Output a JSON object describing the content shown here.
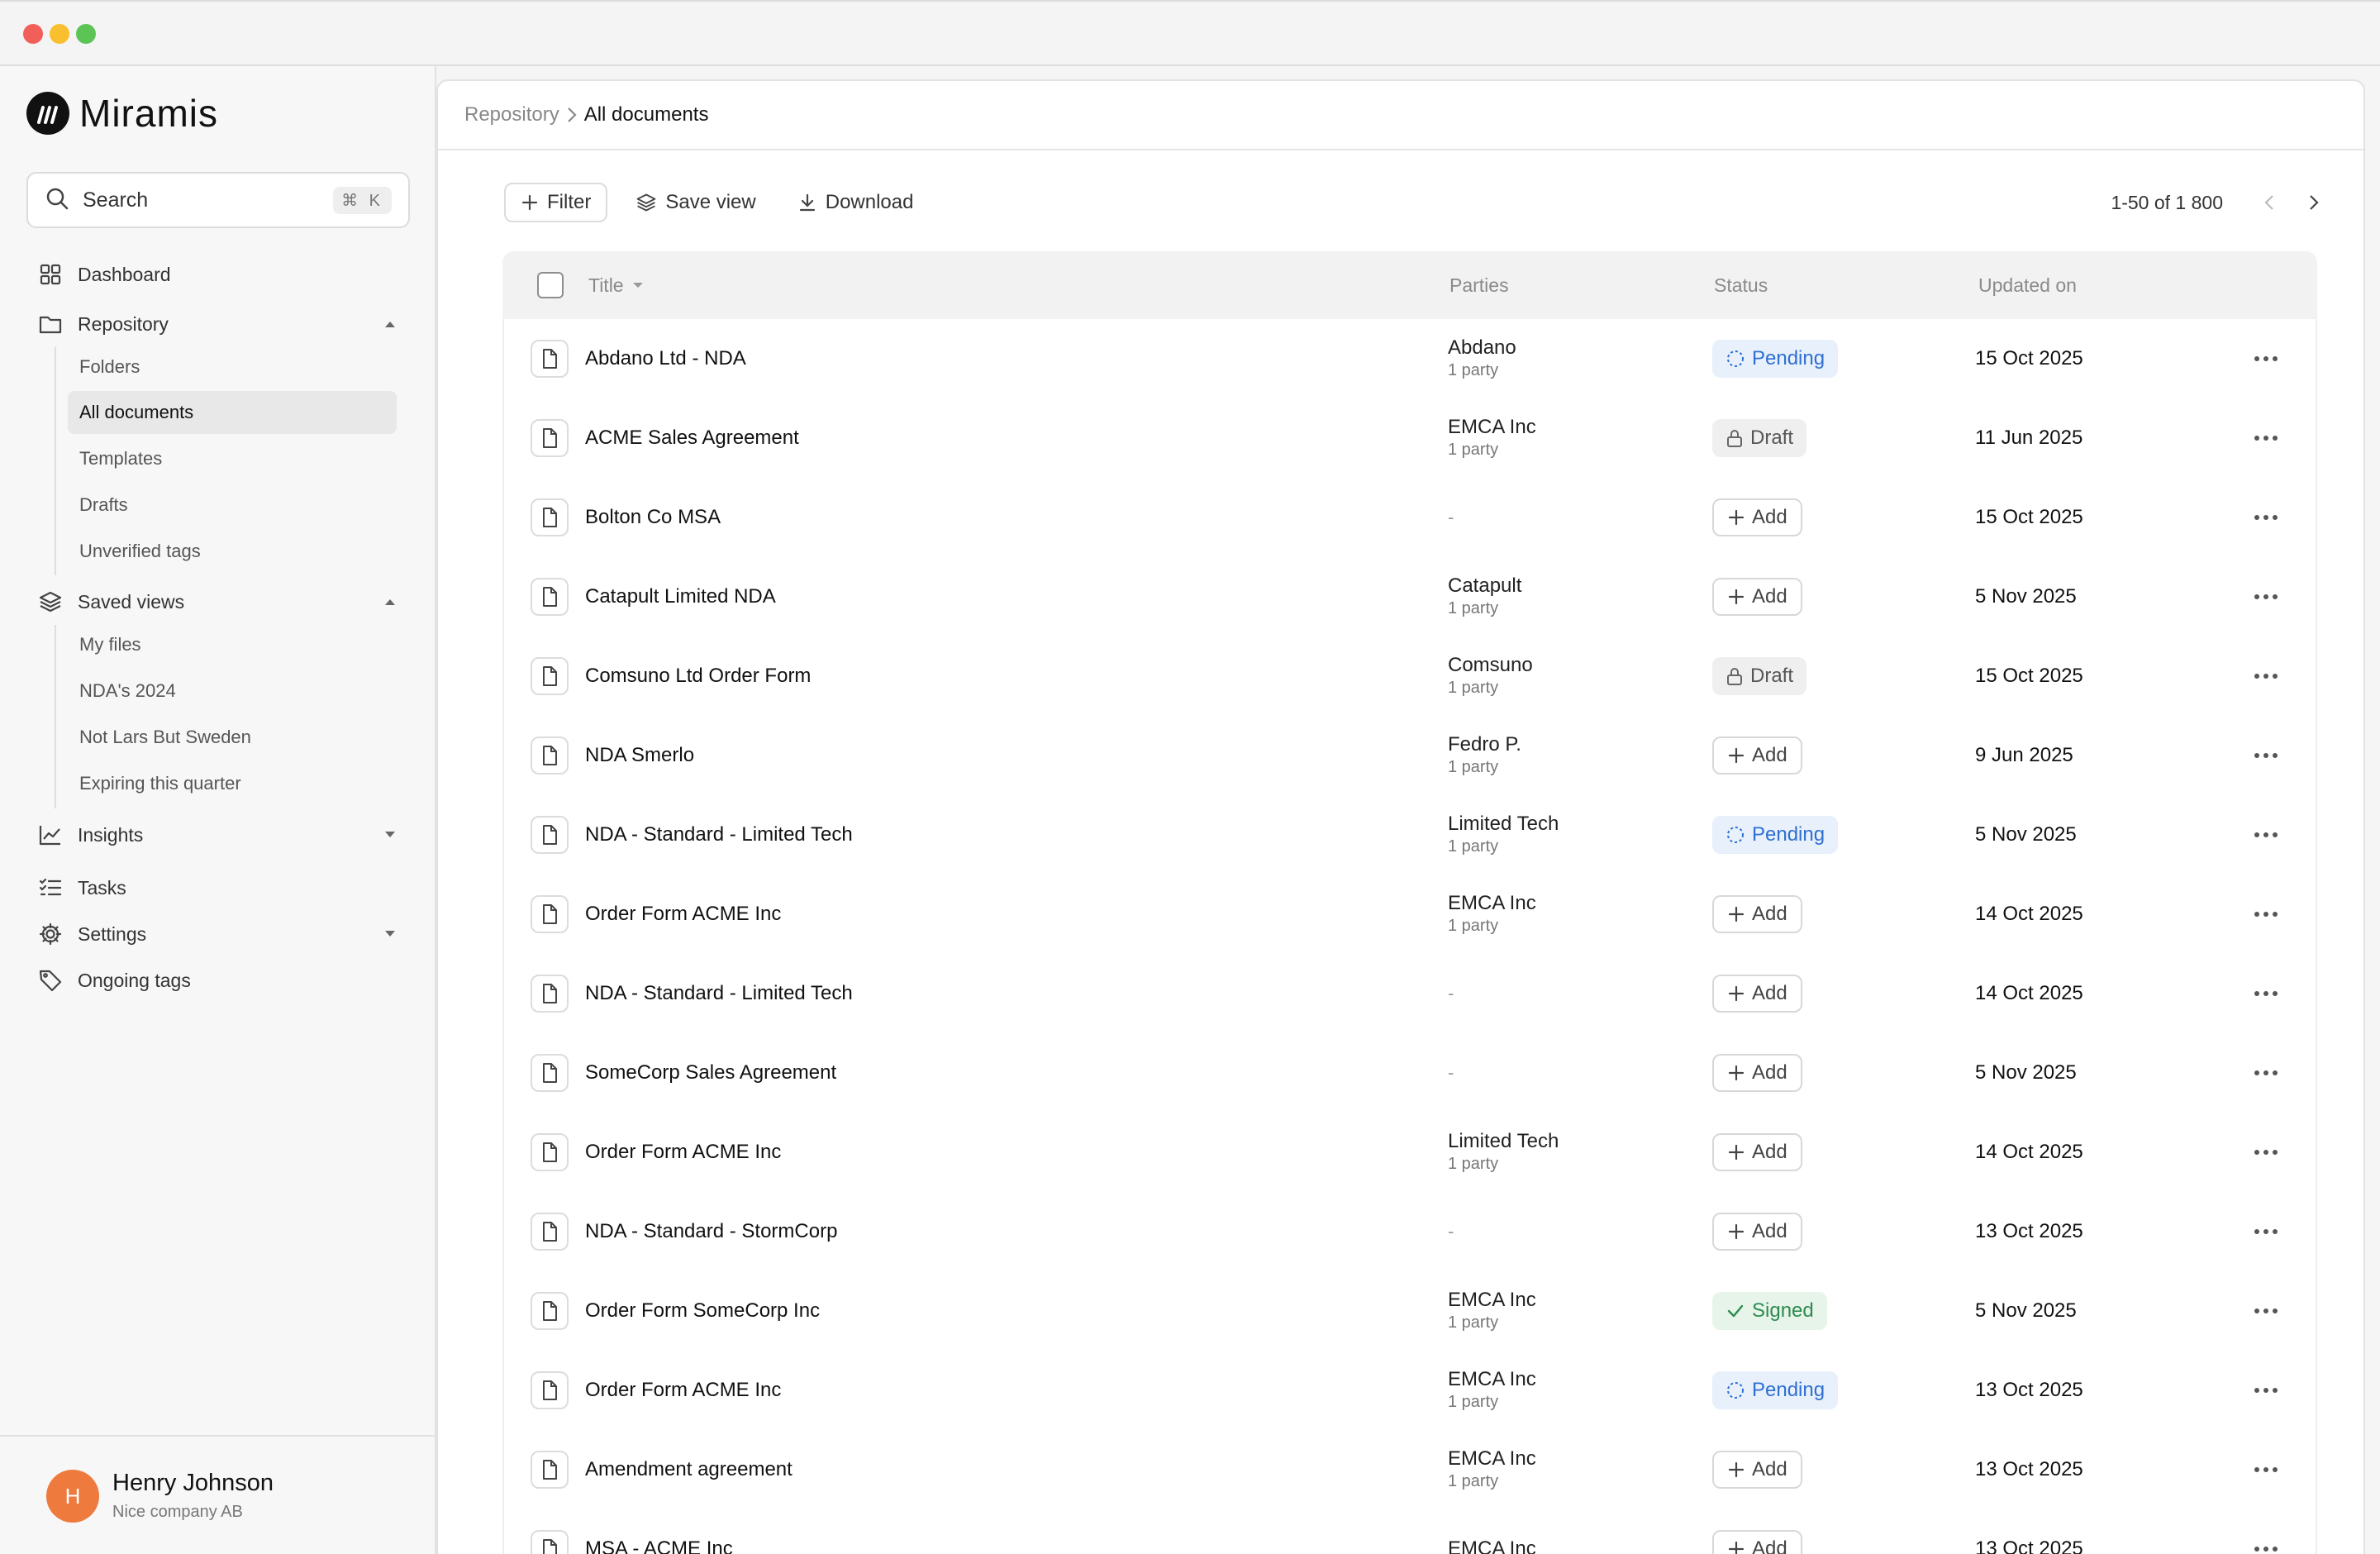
{
  "app": {
    "name": "Miramis"
  },
  "sidebar": {
    "search": {
      "label": "Search",
      "shortcut": "⌘ K"
    },
    "nav": [
      {
        "label": "Dashboard",
        "icon": "grid-icon"
      },
      {
        "label": "Repository",
        "icon": "folder-icon",
        "expanded": true,
        "children": [
          "Folders",
          "All documents",
          "Templates",
          "Drafts",
          "Unverified tags"
        ]
      },
      {
        "label": "Saved views",
        "icon": "layers-icon",
        "expanded": true,
        "children": [
          "My files",
          "NDA's 2024",
          "Not Lars But Sweden",
          "Expiring this quarter"
        ]
      },
      {
        "label": "Insights",
        "icon": "chart-line-icon",
        "expanded": false
      },
      {
        "label": "Tasks",
        "icon": "task-list-icon"
      },
      {
        "label": "Settings",
        "icon": "gear-icon",
        "expanded": false
      },
      {
        "label": "Ongoing tags",
        "icon": "tag-icon"
      }
    ],
    "active_item": "All documents",
    "user": {
      "initial": "H",
      "name": "Henry Johnson",
      "company": "Nice company AB"
    }
  },
  "breadcrumb": {
    "parent": "Repository",
    "current": "All documents"
  },
  "toolbar": {
    "filter": "Filter",
    "save_view": "Save view",
    "download": "Download"
  },
  "pagination": {
    "range": "1-50 of 1 800"
  },
  "table": {
    "headers": {
      "title": "Title",
      "parties": "Parties",
      "status": "Status",
      "updated": "Updated on"
    },
    "rows": [
      {
        "title": "Abdano Ltd - NDA",
        "party": "Abdano",
        "party_count": "1 party",
        "status": "Pending",
        "status_type": "pending",
        "updated": "15 Oct 2025"
      },
      {
        "title": "ACME Sales Agreement",
        "party": "EMCA Inc",
        "party_count": "1 party",
        "status": "Draft",
        "status_type": "draft",
        "updated": "11 Jun 2025"
      },
      {
        "title": "Bolton Co MSA",
        "party": "-",
        "party_count": "",
        "status": "Add",
        "status_type": "add",
        "updated": "15 Oct 2025"
      },
      {
        "title": "Catapult Limited NDA",
        "party": "Catapult",
        "party_count": "1 party",
        "status": "Add",
        "status_type": "add",
        "updated": "5 Nov 2025"
      },
      {
        "title": "Comsuno Ltd Order Form",
        "party": "Comsuno",
        "party_count": "1 party",
        "status": "Draft",
        "status_type": "draft",
        "updated": "15 Oct 2025"
      },
      {
        "title": "NDA Smerlo",
        "party": "Fedro P.",
        "party_count": "1 party",
        "status": "Add",
        "status_type": "add",
        "updated": "9 Jun 2025"
      },
      {
        "title": "NDA - Standard - Limited Tech",
        "party": "Limited Tech",
        "party_count": "1 party",
        "status": "Pending",
        "status_type": "pending",
        "updated": "5 Nov 2025"
      },
      {
        "title": "Order Form ACME Inc",
        "party": "EMCA Inc",
        "party_count": "1 party",
        "status": "Add",
        "status_type": "add",
        "updated": "14 Oct 2025"
      },
      {
        "title": "NDA - Standard - Limited Tech",
        "party": "-",
        "party_count": "",
        "status": "Add",
        "status_type": "add",
        "updated": "14 Oct 2025"
      },
      {
        "title": "SomeCorp Sales Agreement",
        "party": "-",
        "party_count": "",
        "status": "Add",
        "status_type": "add",
        "updated": "5 Nov 2025"
      },
      {
        "title": "Order Form ACME Inc",
        "party": "Limited Tech",
        "party_count": "1 party",
        "status": "Add",
        "status_type": "add",
        "updated": "14 Oct 2025"
      },
      {
        "title": "NDA - Standard - StormCorp",
        "party": "-",
        "party_count": "",
        "status": "Add",
        "status_type": "add",
        "updated": "13 Oct 2025"
      },
      {
        "title": "Order Form SomeCorp Inc",
        "party": "EMCA Inc",
        "party_count": "1 party",
        "status": "Signed",
        "status_type": "signed",
        "updated": "5 Nov 2025"
      },
      {
        "title": "Order Form ACME Inc",
        "party": "EMCA Inc",
        "party_count": "1 party",
        "status": "Pending",
        "status_type": "pending",
        "updated": "13 Oct 2025"
      },
      {
        "title": "Amendment agreement",
        "party": "EMCA Inc",
        "party_count": "1 party",
        "status": "Add",
        "status_type": "add",
        "updated": "13 Oct 2025"
      },
      {
        "title": "MSA - ACME Inc",
        "party": "EMCA Inc",
        "party_count": "",
        "status": "Add",
        "status_type": "add",
        "updated": "13 Oct 2025"
      }
    ]
  },
  "colors": {
    "pending": "#2f6fd1",
    "signed": "#2e8b4e",
    "avatar": "#ee7a3d",
    "brand": "#111111"
  }
}
